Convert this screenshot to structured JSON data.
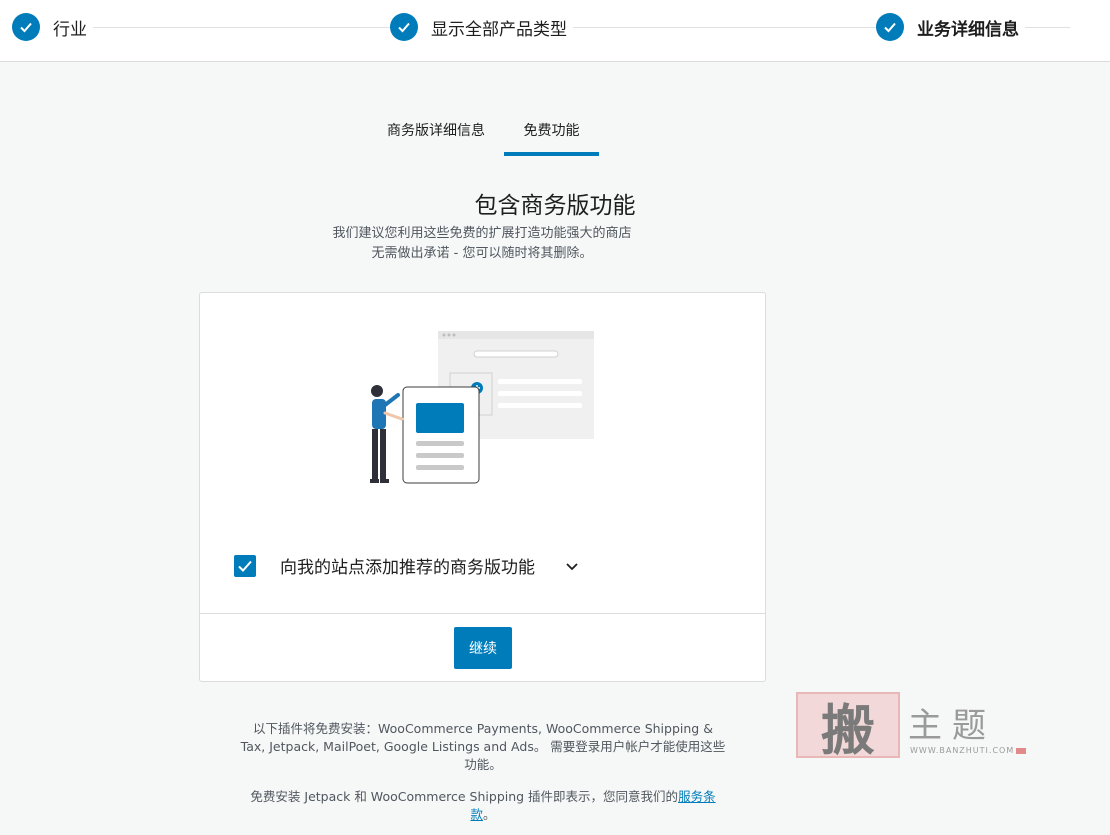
{
  "stepper": {
    "steps": [
      {
        "label": "行业",
        "done": true
      },
      {
        "label": "显示全部产品类型",
        "done": true
      },
      {
        "label": "业务详细信息",
        "done": true,
        "current": true
      }
    ]
  },
  "tabs": [
    {
      "label": "商务版详细信息",
      "active": false
    },
    {
      "label": "免费功能",
      "active": true
    }
  ],
  "main": {
    "heading": "包含商务版功能",
    "subtitle_line1": "我们建议您利用这些免费的扩展打造功能强大的商店",
    "subtitle_line2": "无需做出承诺 - 您可以随时将其删除。"
  },
  "card": {
    "checkbox_label": "向我的站点添加推荐的商务版功能",
    "checkbox_checked": true,
    "continue_label": "继续"
  },
  "footer": {
    "plugins_note": "以下插件将免费安装：WooCommerce Payments, WooCommerce Shipping & Tax, Jetpack, MailPoet, Google Listings and Ads。 需要登录用户帐户才能使用这些功能。",
    "terms_prefix": "免费安装 Jetpack 和 WooCommerce Shipping 插件即表示，您同意我们的",
    "terms_link": "服务条款",
    "terms_suffix": "。"
  },
  "watermark": {
    "stamp_char": "搬",
    "text": "主题",
    "url": "WWW.BANZHUTI.COM"
  },
  "colors": {
    "accent": "#007cba",
    "background": "#f6f7f7"
  }
}
